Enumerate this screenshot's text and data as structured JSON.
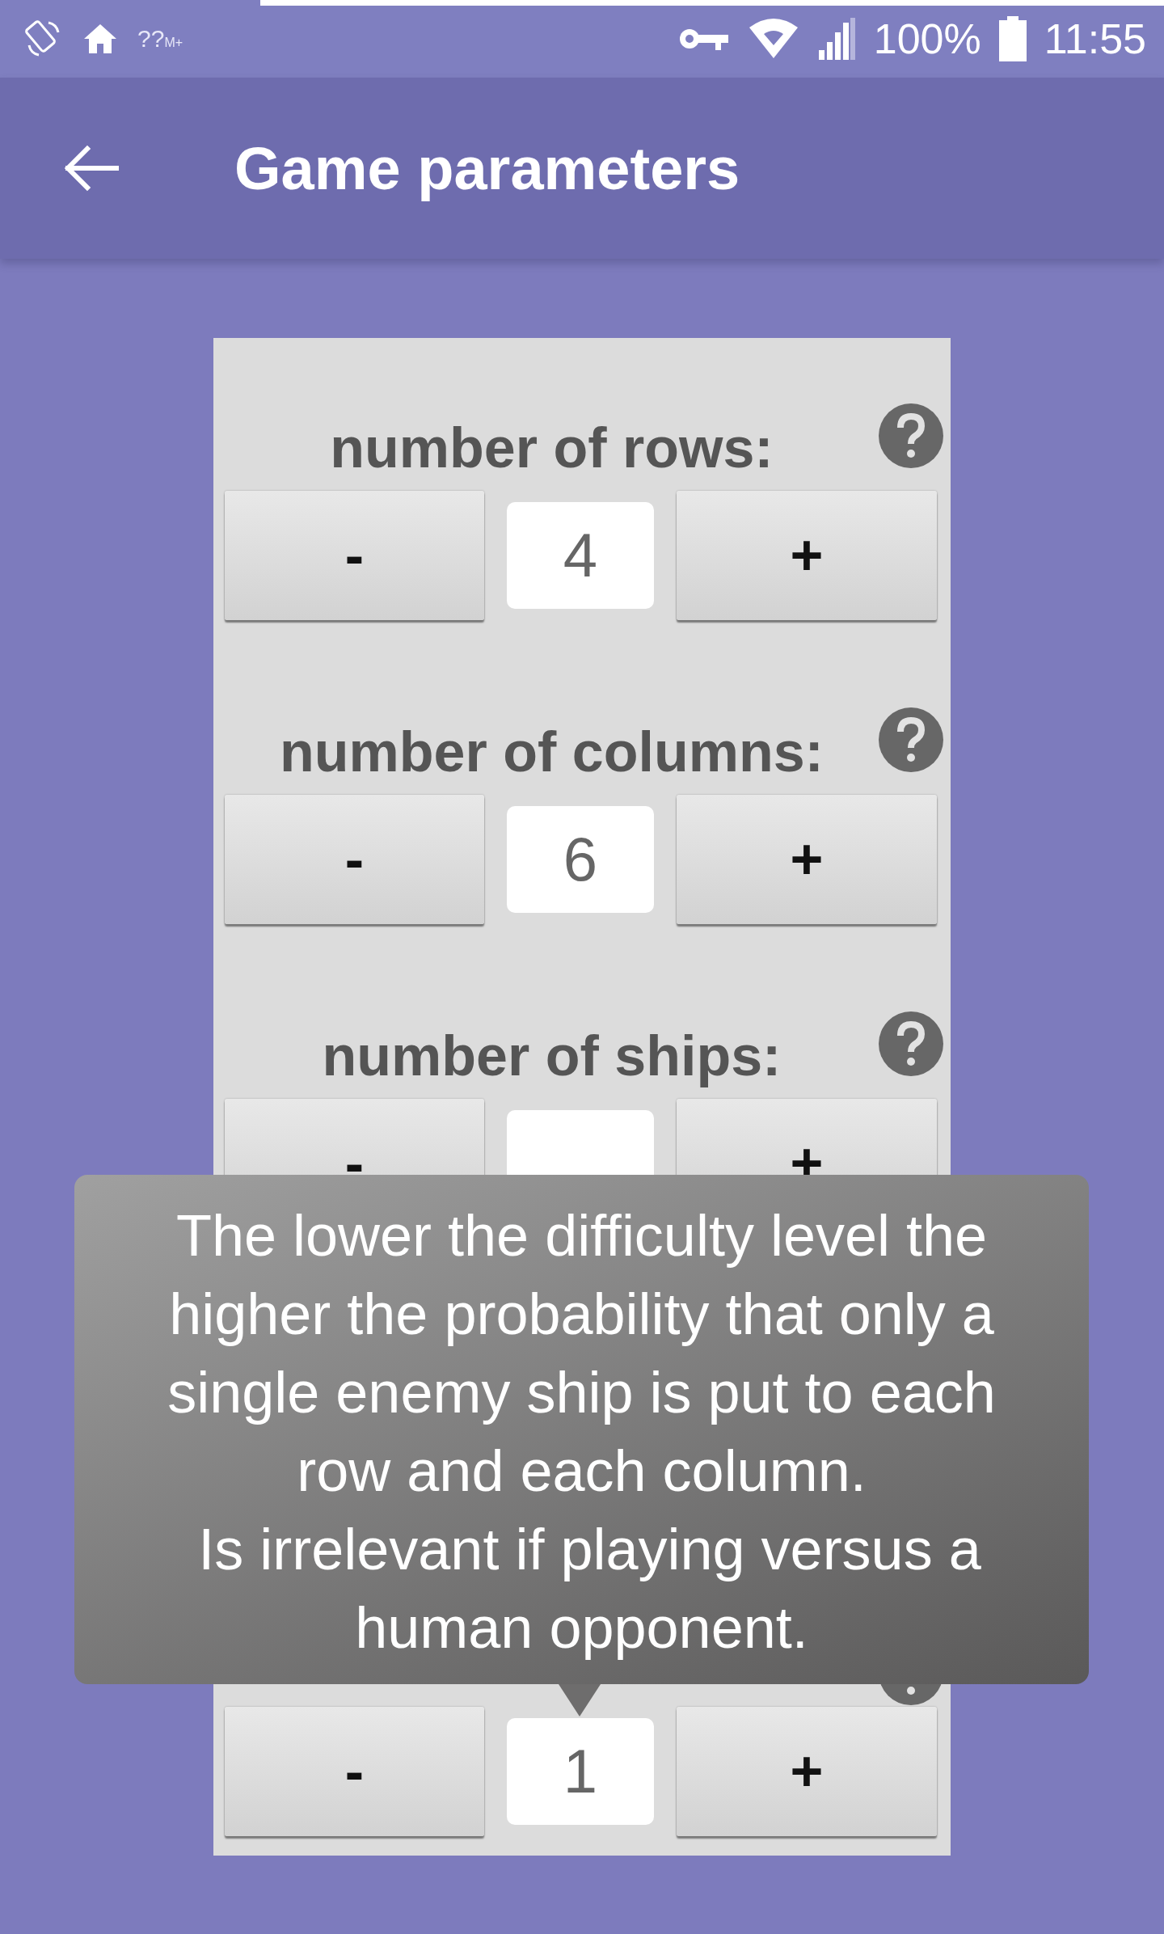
{
  "status_bar": {
    "notification_text": "??",
    "notification_sub": "M+",
    "battery": "100%",
    "time": "11:55"
  },
  "app_bar": {
    "title": "Game parameters"
  },
  "rows": [
    {
      "label": "number of rows:",
      "minus": "-",
      "value": "4",
      "plus": "+"
    },
    {
      "label": "number of columns:",
      "minus": "-",
      "value": "6",
      "plus": "+"
    },
    {
      "label": "number of ships:",
      "minus": "-",
      "plus": "+"
    },
    {
      "minus": "-",
      "value": "1",
      "plus": "+"
    }
  ],
  "tooltip": {
    "text": "The lower the difficulty level the\nhigher the probability that only a\nsingle enemy ship is put to each\nrow and each column.\n Is irrelevant if playing versus a\nhuman opponent."
  }
}
